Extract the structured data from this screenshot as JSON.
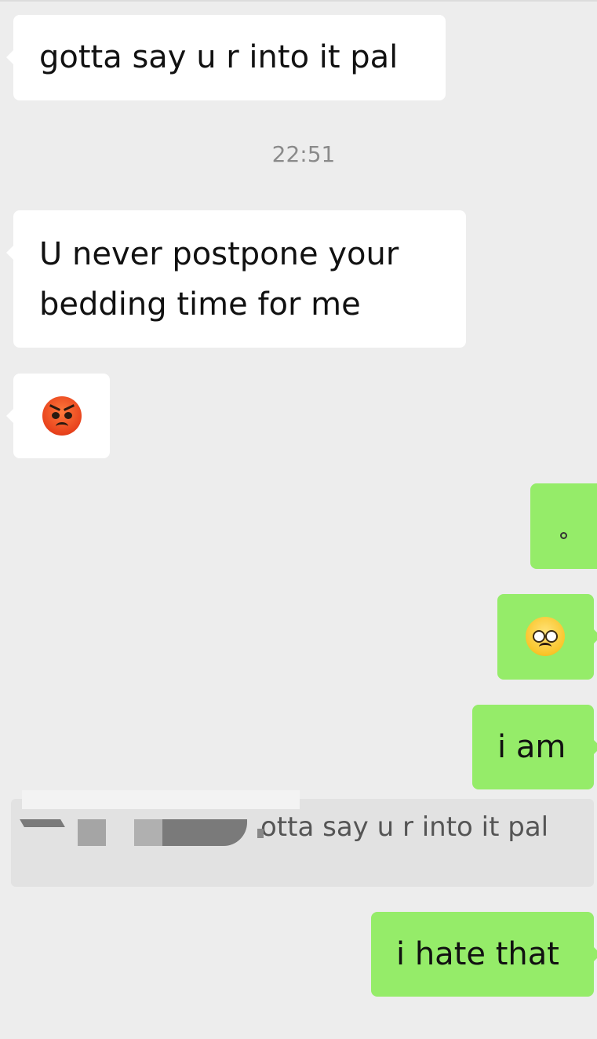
{
  "messages": [
    {
      "id": "m1",
      "side": "incoming",
      "text": "gotta say u r into it pal"
    },
    {
      "id": "m2",
      "side": "incoming",
      "text": "U never postpone your\nbedding time for me"
    },
    {
      "id": "m3",
      "side": "incoming",
      "emoji": "angry-face-icon"
    },
    {
      "id": "m4",
      "side": "outgoing",
      "emoji": "small-circle-icon"
    },
    {
      "id": "m5",
      "side": "outgoing",
      "emoji": "pleading-face-icon"
    },
    {
      "id": "m6",
      "side": "outgoing",
      "text": "i am"
    },
    {
      "id": "m7",
      "side": "outgoing",
      "text": "i hate that"
    }
  ],
  "timestamp": "22:51",
  "quote": {
    "text": "otta say u r into it pal",
    "redacted": true
  },
  "colors": {
    "background": "#ededed",
    "incoming_bubble": "#ffffff",
    "outgoing_bubble": "#95ec69",
    "timestamp_text": "#8a8a8a",
    "quote_background": "#e2e2e2"
  }
}
